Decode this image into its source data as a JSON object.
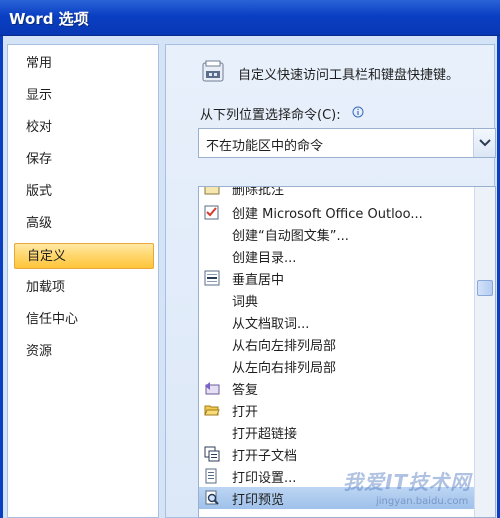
{
  "window": {
    "title": "Word 选项"
  },
  "sidebar": {
    "items": [
      {
        "label": "常用"
      },
      {
        "label": "显示"
      },
      {
        "label": "校对"
      },
      {
        "label": "保存"
      },
      {
        "label": "版式"
      },
      {
        "label": "高级"
      },
      {
        "label": "自定义",
        "selected": true
      },
      {
        "label": "加载项"
      },
      {
        "label": "信任中心"
      },
      {
        "label": "资源"
      }
    ]
  },
  "main": {
    "header_text": "自定义快速访问工具栏和键盘快捷键。",
    "choose_commands_label": "从下列位置选择命令(C):",
    "choose_commands_value": "不在功能区中的命令",
    "commands": [
      {
        "label": "删除批注",
        "icon": "comment-icon",
        "clipped": true
      },
      {
        "label": "创建 Microsoft Office Outloo...",
        "icon": "outlook-task-icon"
      },
      {
        "label": "创建“自动图文集”...",
        "icon": ""
      },
      {
        "label": "创建目录...",
        "icon": ""
      },
      {
        "label": "垂直居中",
        "icon": "align-middle-icon"
      },
      {
        "label": "词典",
        "icon": ""
      },
      {
        "label": "从文档取词...",
        "icon": ""
      },
      {
        "label": "从右向左排列局部",
        "icon": ""
      },
      {
        "label": "从左向右排列局部",
        "icon": ""
      },
      {
        "label": "答复",
        "icon": "reply-icon"
      },
      {
        "label": "打开",
        "icon": "open-folder-icon"
      },
      {
        "label": "打开超链接",
        "icon": ""
      },
      {
        "label": "打开子文档",
        "icon": "subdocument-icon"
      },
      {
        "label": "打印设置...",
        "icon": "print-setup-icon"
      },
      {
        "label": "打印预览",
        "icon": "print-preview-icon",
        "selected": true
      }
    ]
  },
  "watermark": {
    "text": "我爱IT技术网",
    "sub": "jingyan.baidu.com"
  },
  "colors": {
    "titlebar": "#0a3fc3",
    "selection_gold": "#ffd66b",
    "list_selection": "#9fc1ea",
    "panel_bg": "#dce8f8"
  }
}
